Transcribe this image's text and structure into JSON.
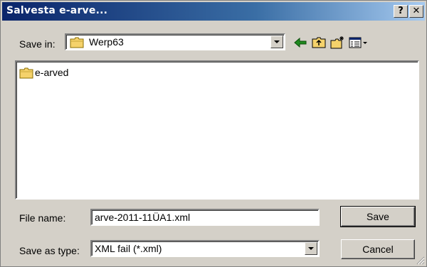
{
  "window": {
    "title": "Salvesta e-arve...",
    "help_label": "?",
    "close_label": "✕"
  },
  "location": {
    "label": "Save in:",
    "value": "Werp63"
  },
  "toolbar": {
    "icons": [
      "back-arrow-icon",
      "up-folder-icon",
      "new-folder-icon",
      "view-menu-icon"
    ]
  },
  "files": [
    {
      "name": "e-arved",
      "type": "folder"
    }
  ],
  "form": {
    "file_name_label": "File name:",
    "file_name_value": "arve-2011-11ÜA1.xml",
    "file_type_label": "Save as type:",
    "file_type_value": "XML fail (*.xml)"
  },
  "buttons": {
    "save_label": "Save",
    "cancel_label": "Cancel"
  },
  "colors": {
    "title_start": "#0a246a",
    "title_end": "#a6caf0",
    "face": "#d4d0c8",
    "folder": "#f5d26b"
  }
}
